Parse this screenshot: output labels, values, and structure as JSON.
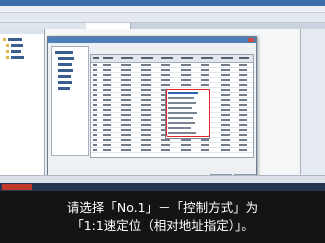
{
  "subtitle": {
    "line1": "请选择「No.1」－「控制方式」为",
    "line2": "「1:1速定位（相对地址指定）」。"
  },
  "colors": {
    "highlight": "#e0262b",
    "titlebar": "#3d6fa8",
    "caption_background": "#141414",
    "caption_text": "#ffffff"
  },
  "icons": [
    "close-icon",
    "folder-icon"
  ]
}
